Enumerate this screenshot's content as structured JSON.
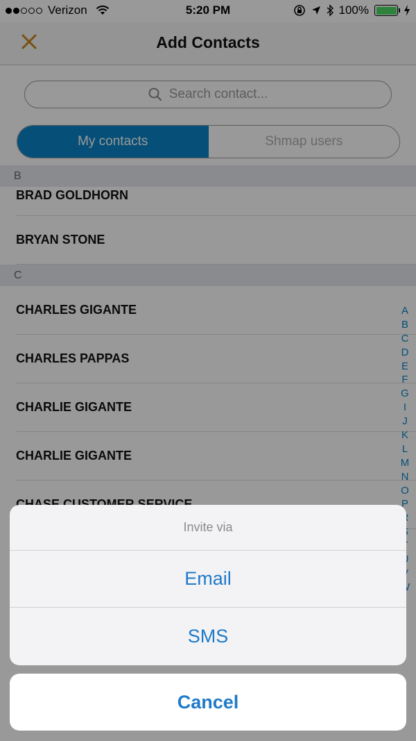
{
  "status_bar": {
    "carrier": "Verizon",
    "time": "5:20 PM",
    "battery": "100%",
    "colors": {
      "battery": "#4cd964"
    }
  },
  "nav": {
    "title": "Add Contacts",
    "close_icon": "close-icon",
    "accent": "#c8861a"
  },
  "search": {
    "placeholder": "Search contact..."
  },
  "tabs": [
    {
      "label": "My contacts",
      "active": true
    },
    {
      "label": "Shmap users",
      "active": false
    }
  ],
  "sections": [
    {
      "letter": "B",
      "contacts": [
        "BRAD GOLDHORN",
        "BRYAN STONE"
      ]
    },
    {
      "letter": "C",
      "contacts": [
        "CHARLES GIGANTE",
        "CHARLES PAPPAS",
        "CHARLIE GIGANTE",
        "CHARLIE GIGANTE",
        "CHASE CUSTOMER SERVICE"
      ]
    }
  ],
  "index_letters": [
    "A",
    "B",
    "C",
    "D",
    "E",
    "F",
    "G",
    "I",
    "J",
    "K",
    "L",
    "M",
    "N",
    "O",
    "P",
    "R",
    "S",
    "T",
    "U",
    "V",
    "W"
  ],
  "action_sheet": {
    "title": "Invite via",
    "options": [
      "Email",
      "SMS"
    ],
    "cancel": "Cancel",
    "accent": "#1f7ac8"
  }
}
